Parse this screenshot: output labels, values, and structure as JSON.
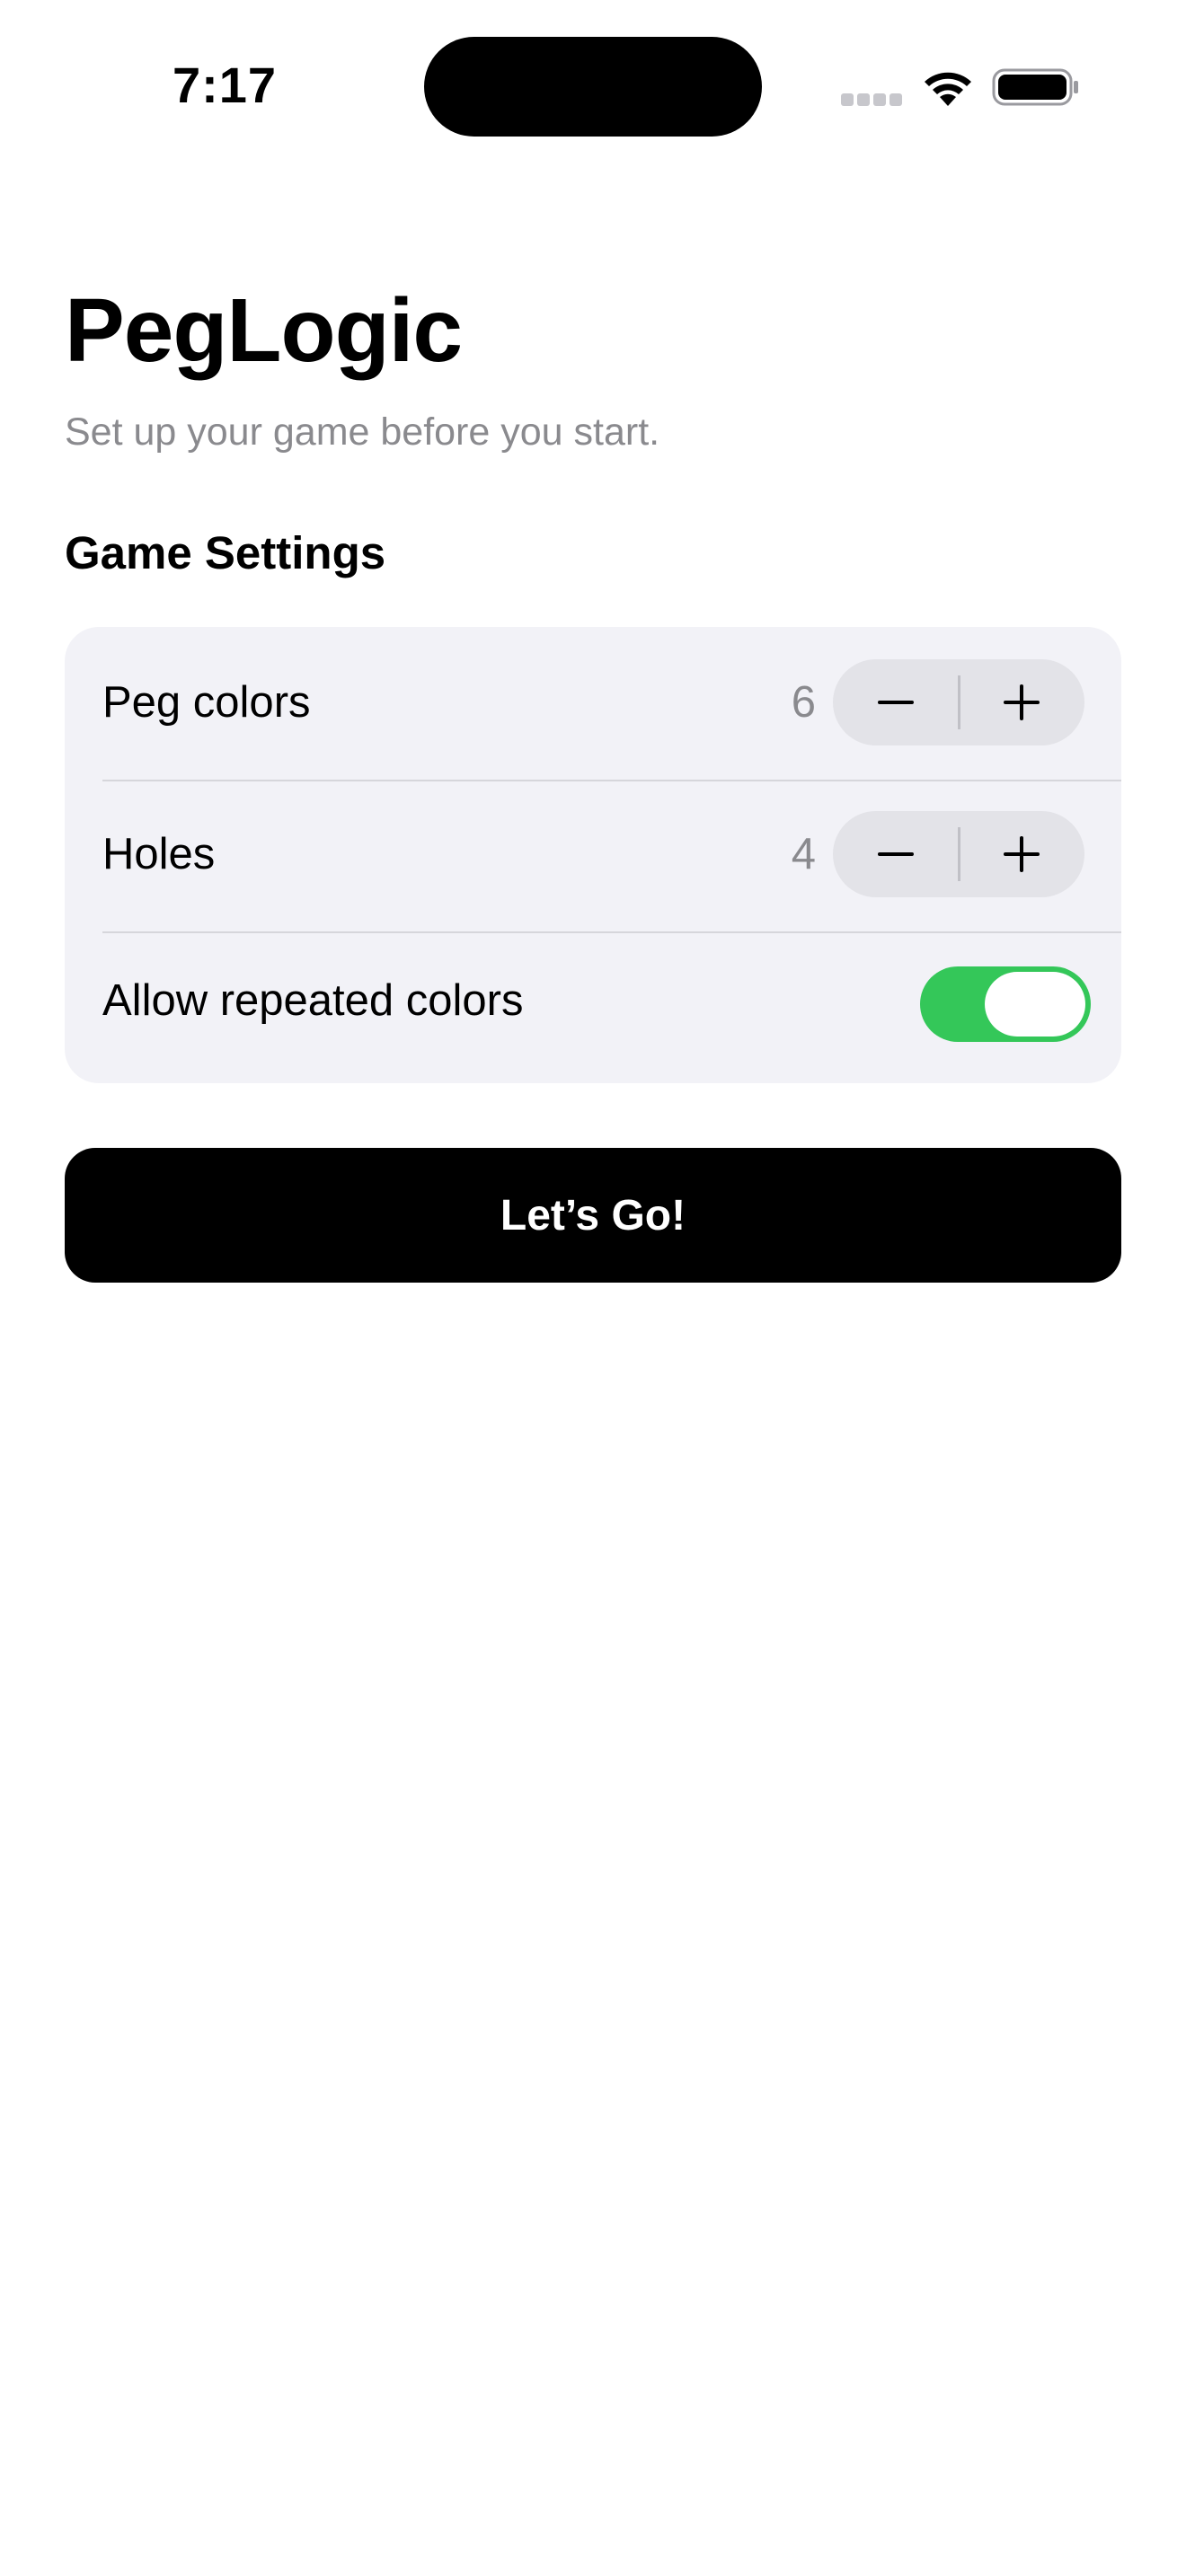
{
  "status_bar": {
    "time": "7:17",
    "signal_icon": "cellular-signal-icon",
    "wifi_icon": "wifi-icon",
    "battery_icon": "battery-icon"
  },
  "app": {
    "title": "PegLogic",
    "subtitle": "Set up your game before you start."
  },
  "settings": {
    "header": "Game Settings",
    "peg_colors": {
      "label": "Peg colors",
      "value": "6",
      "decrement_icon": "minus-icon",
      "increment_icon": "plus-icon"
    },
    "holes": {
      "label": "Holes",
      "value": "4",
      "decrement_icon": "minus-icon",
      "increment_icon": "plus-icon"
    },
    "allow_repeated_colors": {
      "label": "Allow repeated colors",
      "enabled": true
    }
  },
  "actions": {
    "start_label": "Let’s Go!"
  },
  "colors": {
    "accent_green": "#34c759",
    "card_background": "#f2f2f7",
    "stepper_background": "#e3e3e8",
    "secondary_text": "#8a8a8e",
    "primary_button": "#000000"
  }
}
